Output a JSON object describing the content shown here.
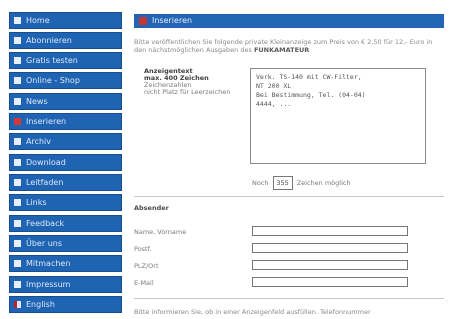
{
  "sidebar": {
    "items": [
      {
        "label": "Home",
        "icon": "bullet"
      },
      {
        "label": "Abonnieren",
        "icon": "bullet"
      },
      {
        "label": "Gratis testen",
        "icon": "bullet"
      },
      {
        "label": "Online - Shop",
        "icon": "bullet"
      },
      {
        "label": "News",
        "icon": "bullet"
      },
      {
        "label": "Inserieren",
        "icon": "flag-de"
      },
      {
        "label": "Archiv",
        "icon": "bullet"
      },
      {
        "label": "Download",
        "icon": "bullet"
      },
      {
        "label": "Leitfaden",
        "icon": "bullet"
      },
      {
        "label": "Links",
        "icon": "bullet"
      },
      {
        "label": "Feedback",
        "icon": "bullet"
      },
      {
        "label": "Über uns",
        "icon": "bullet"
      },
      {
        "label": "Mitmachen",
        "icon": "bullet"
      },
      {
        "label": "Impressum",
        "icon": "bullet"
      },
      {
        "label": "English",
        "icon": "flag-en"
      }
    ]
  },
  "header": {
    "title": "Inserieren"
  },
  "intro": {
    "text": "Bitte veröffentlichen Sie folgende private Kleinanzeige zum Preis von € 2,50 für 12,- Euro in den nächstmöglichen Ausgaben des",
    "emphasis": "FUNKAMATEUR"
  },
  "ad_form": {
    "label_title": "Anzeigentext",
    "label_lines": [
      "max. 400 Zeichen",
      "Zeichenzahlen",
      "nicht Platz für Leerzeichen"
    ],
    "textarea_value": "Verk. TS-140 mit CW-Filter,\nNT 200 XL\nBei Bestimmung, Tel. (04-04)\n4444, ...",
    "char_prefix": "Noch",
    "char_count": "355",
    "char_suffix": "Zeichen möglich"
  },
  "contact": {
    "section_title": "Absender",
    "fields": [
      {
        "label": "Name, Vorname"
      },
      {
        "label": "Postf."
      },
      {
        "label": "PLZ/Ort"
      },
      {
        "label": "E-Mail"
      }
    ]
  },
  "footer": {
    "note": "Bitte informieren Sie, ob in einer Anzeigenfeld ausfüllen. Telefonnummer"
  },
  "colors": {
    "nav_bg": "#1f63b3",
    "header_bg": "#2265b5",
    "accent": "#c73636"
  }
}
